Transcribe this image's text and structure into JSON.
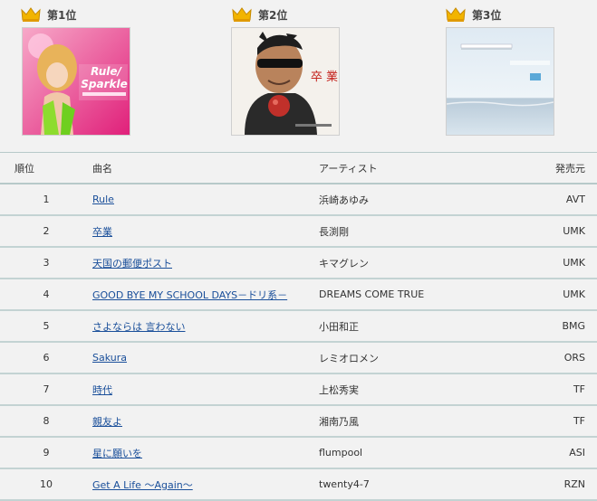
{
  "top3": [
    {
      "label": "第1位",
      "jacket_title": "Rule/ Sparkle"
    },
    {
      "label": "第2位",
      "jacket_title": "卒業"
    },
    {
      "label": "第3位",
      "jacket_title": ""
    }
  ],
  "table": {
    "headers": {
      "rank": "順位",
      "title": "曲名",
      "artist": "アーティスト",
      "label": "発売元"
    },
    "rows": [
      {
        "rank": "1",
        "title": "Rule",
        "artist": "浜崎あゆみ",
        "label": "AVT"
      },
      {
        "rank": "2",
        "title": "卒業",
        "artist": "長渕剛",
        "label": "UMK"
      },
      {
        "rank": "3",
        "title": "天国の郵便ポスト",
        "artist": "キマグレン",
        "label": "UMK"
      },
      {
        "rank": "4",
        "title": "GOOD BYE MY SCHOOL DAYS－ドリ系－",
        "artist": "DREAMS COME TRUE",
        "label": "UMK"
      },
      {
        "rank": "5",
        "title": "さよならは 言わない",
        "artist": "小田和正",
        "label": "BMG"
      },
      {
        "rank": "6",
        "title": "Sakura",
        "artist": "レミオロメン",
        "label": "ORS"
      },
      {
        "rank": "7",
        "title": "時代",
        "artist": "上松秀実",
        "label": "TF"
      },
      {
        "rank": "8",
        "title": "親友よ",
        "artist": "湘南乃風",
        "label": "TF"
      },
      {
        "rank": "9",
        "title": "星に願いを",
        "artist": "flumpool",
        "label": "ASI"
      },
      {
        "rank": "10",
        "title": "Get A Life ～Again～",
        "artist": "twenty4-7",
        "label": "RZN"
      }
    ]
  },
  "colors": {
    "link": "#1a4f9a",
    "crown": "#f2b400",
    "divider": "#c3d3d3"
  }
}
